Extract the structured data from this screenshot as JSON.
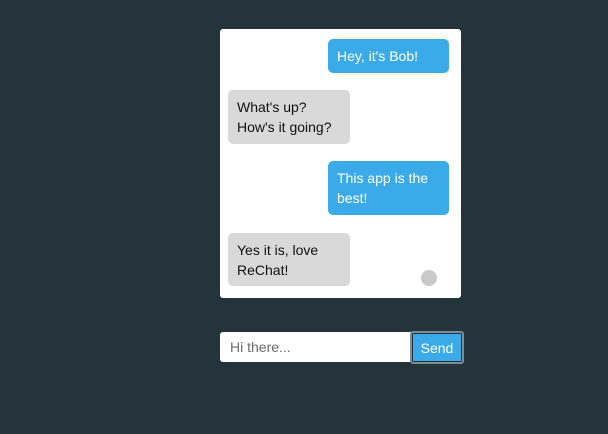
{
  "messages": [
    {
      "sender": "me",
      "text": "Hey, it's Bob!"
    },
    {
      "sender": "other",
      "text": "What's up? How's it going?"
    },
    {
      "sender": "me",
      "text": "This app is the best!"
    },
    {
      "sender": "other",
      "text": "Yes it is, love ReChat!"
    }
  ],
  "composer": {
    "placeholder": "Hi there...",
    "value": "",
    "send_label": "Send"
  },
  "colors": {
    "background": "#25333a",
    "sent_bubble": "#3aabe8",
    "received_bubble": "#d9d9d9",
    "panel": "#ffffff"
  }
}
